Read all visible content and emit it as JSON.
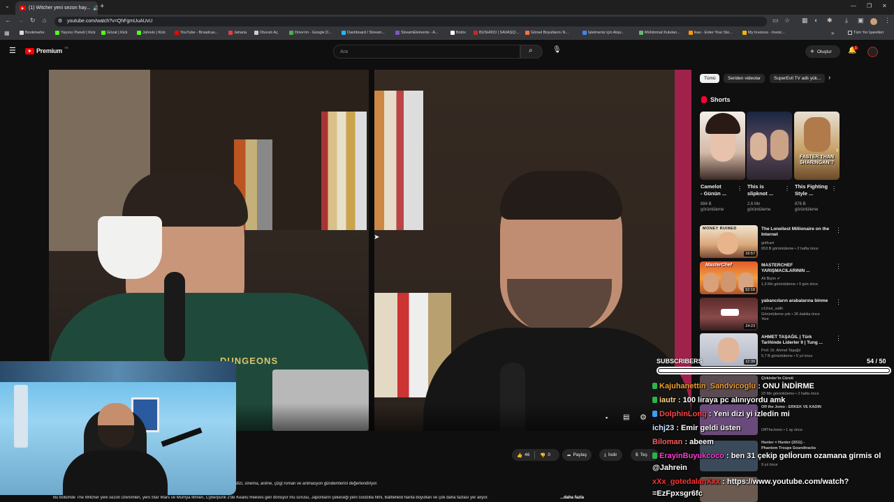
{
  "browser": {
    "tab_title": "(1) Witcher yeni sezon hay...",
    "url": "youtube.com/watch?v=QhFgmUuAUvU",
    "bookmarks": [
      "Bookmarks",
      "Yayıncı Paneli | Kick",
      "Gözat | Kick",
      "Jahrein | Kick",
      "YouTube - Broadcas...",
      "Jaharia",
      "Oturum Aç",
      "Drive'ım - Google D...",
      "Dashboard / Stream...",
      "StreamElements - A...",
      "Botrix",
      "BUSHIDO | SAVAŞÇI...",
      "Görsel Boyutlarını N...",
      "İşletmeniz için Alışv...",
      "Mühimmat Kutuları...",
      "ikas - Enter Your Sto...",
      "My Invoices - Invoic..."
    ],
    "all_bookmarks": "Tüm Yer İşaretleri"
  },
  "youtube": {
    "logo": "Premium",
    "logo_sup": "TR",
    "search_placeholder": "Ara",
    "create_label": "Oluştur",
    "notif_count": "1"
  },
  "sidebar": {
    "chips": [
      "Tümü",
      "Seriden videolar",
      "SuperEvil TV adlı yük..."
    ],
    "shorts_title": "Shorts",
    "shorts": [
      {
        "title1": "Camelot",
        "title2": "- Günün ...",
        "views": "884 B",
        "views2": "görüntüleme"
      },
      {
        "title1": "This is",
        "title2": "slipknot ...",
        "views": "2,6 Mn",
        "views2": "görüntüleme"
      },
      {
        "title1": "This Fighting",
        "title2": "Style ...",
        "views": "876 B",
        "views2": "görüntüleme",
        "overlay": "FASTER THAN SHARINGAN!?"
      }
    ],
    "videos": [
      {
        "title1": "The Loneliest Millionaire on the",
        "title2": "Internet",
        "channel": "golfcart",
        "meta": "653 B görüntüleme • 2 hafta önce",
        "duration": "16:57",
        "thumb_text": "MONEY RUINED"
      },
      {
        "title1": "MASTERCHEF",
        "title2": "YARIŞMACILARININ ...",
        "channel": "Ali Biçim",
        "meta": "1,6 Mn görüntüleme • 9 gün önce",
        "duration": "52:18",
        "thumb_text": "MasterChef"
      },
      {
        "title1": "yabancıların arabalarına binme",
        "title2": "",
        "channel": "v12nur_salih",
        "meta": "Görüntüleme yok • 26 dakika önce",
        "meta2": "Yeni",
        "duration": "24:23"
      },
      {
        "title1": "AHMET TAŞAĞIL | Türk",
        "title2": "Tarihinde Liderler 9 | Tung ...",
        "channel": "Prof. Dr. Ahmet Taşağıl",
        "meta": "5,7 B görüntüleme • 5 yıl önce",
        "duration": "12:39"
      }
    ],
    "partial_rows": [
      {
        "title": "Çirkinler'in Cüreti",
        "meta": "23 Mn görüntüleme • 2 hafta önce"
      },
      {
        "title": "Off the Jomo - ERKEK VE KADIN",
        "meta": "OffTheJomo • 1 ay önce"
      },
      {
        "title": "Hunter × Hunter (2011) -",
        "title2": "Phantom Troupe Soundtracks",
        "meta": "9 yıl önce"
      }
    ]
  },
  "video": {
    "hoodie_text": "DUNGEONS",
    "likes": "46",
    "dislikes": "0",
    "share": "Paylaş",
    "download": "İndir",
    "thanks": "Teş",
    "desc1": "dizi, sinema, anime, çizgi roman ve animasyon gündemlerini değerlendiriyor.",
    "desc2": "Bu bölümde The Witcher yeni sezon izlenimleri, yeni Star Wars ve Mumya filmleri, Cyberpunk 2'de Keanu Reeves geri dönüyor mu sorusu, Japonların çekeceği yeni Godzilla filmi, Battlefield harita boyutları ve çok daha fazlası yer alıyor.",
    "desc_more": "...daha fazla"
  },
  "overlay": {
    "subs_label": "SUBSCRIBERS",
    "subs_count": "54 / 50",
    "subs_progress": 1.0,
    "chat": [
      {
        "name": "Kajuhanettin_Sandvicoglu",
        "name_color": "#f0a030",
        "badge": "#2bb24c",
        "msg": " : ONU İNDİRME"
      },
      {
        "name": "iautr",
        "name_color": "#ffd28a",
        "badge": "#2bb24c",
        "msg": " : 100 liraya pc alınıyordu amk"
      },
      {
        "name": "DolphinLong",
        "name_color": "#ff4444",
        "badge": "#3aa0ff",
        "msg": " : Yeni dizi yi izledin mi"
      },
      {
        "name": "ichj23",
        "name_color": "#cfe7ff",
        "badge": "",
        "msg": " : Emir geldi üsten"
      },
      {
        "name": "Biloman",
        "name_color": "#ff5a5a",
        "badge": "",
        "msg": " : abeem"
      },
      {
        "name": "ErayinBuyukcoco",
        "name_color": "#ff3ad4",
        "badge": "#2bb24c",
        "msg": " : ben 31 çekip gelİorum ozamana girmis ol"
      },
      {
        "name": "",
        "name_color": "#fff",
        "badge": "",
        "msg": "@Jahrein"
      },
      {
        "name": "xXx_gotedalanXxx",
        "name_color": "#ff3030",
        "badge": "",
        "msg": " : https://www.youtube.com/watch?"
      },
      {
        "name": "",
        "name_color": "#fff",
        "badge": "",
        "msg": "=EzFpxsgr6fc"
      }
    ]
  },
  "colors": {
    "yt_red": "#ff0000",
    "bg": "#0f0f0f",
    "chip": "#272727"
  }
}
